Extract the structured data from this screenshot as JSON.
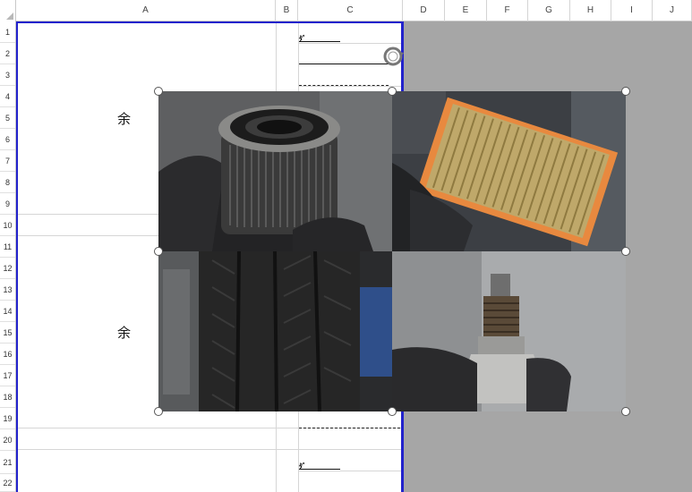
{
  "columns": [
    "A",
    "B",
    "C",
    "D",
    "E",
    "F",
    "G",
    "H",
    "I",
    "J"
  ],
  "rows": [
    "1",
    "2",
    "3",
    "4",
    "5",
    "6",
    "7",
    "8",
    "9",
    "10",
    "11",
    "12",
    "13",
    "14",
    "15",
    "16",
    "17",
    "18",
    "19",
    "20",
    "21",
    "22"
  ],
  "cells": {
    "a4_text": "余",
    "a15_text": "余",
    "c1_text": "ﾀﾞ",
    "c21_text": "ﾀﾞ"
  },
  "images": [
    {
      "name": "oil-filter-photo"
    },
    {
      "name": "air-filter-photo"
    },
    {
      "name": "tire-photo"
    },
    {
      "name": "spark-plug-photo"
    }
  ],
  "colors": {
    "page_border": "#2222cc",
    "outside_area": "#a6a6a6",
    "air_filter": "#e8893f"
  }
}
